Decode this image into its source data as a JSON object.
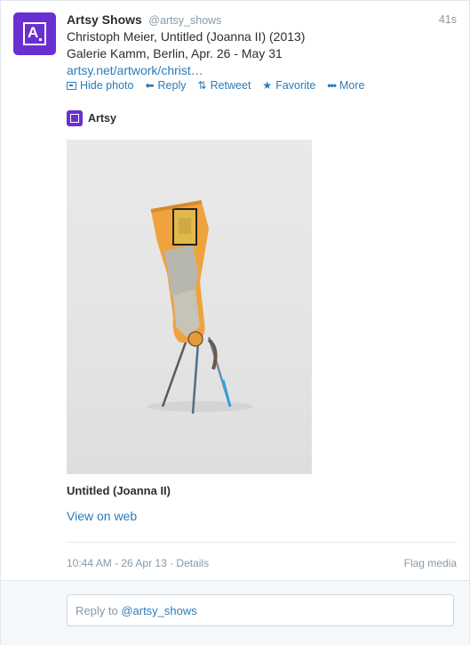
{
  "tweet": {
    "author_name": "Artsy Shows",
    "author_handle": "@artsy_shows",
    "time_ago": "41s",
    "line1": "Christoph Meier, Untitled (Joanna II) (2013)",
    "line2": "Galerie Kamm, Berlin, Apr. 26 - May 31",
    "link": "artsy.net/artwork/christ…"
  },
  "actions": {
    "hide_photo": "Hide photo",
    "reply": "Reply",
    "retweet": "Retweet",
    "favorite": "Favorite",
    "more": "More"
  },
  "card": {
    "brand": "Artsy",
    "artwork_title": "Untitled (Joanna II)",
    "view_on_web": "View on web"
  },
  "meta": {
    "timestamp": "10:44 AM - 26 Apr 13",
    "separator": " · ",
    "details": "Details",
    "flag_media": "Flag media"
  },
  "reply": {
    "prefix": "Reply to ",
    "handle": "@artsy_shows"
  },
  "colors": {
    "brand_purple": "#6a2fd1",
    "link_blue": "#2b7bb9",
    "muted_gray": "#8899a6"
  },
  "icons": {
    "hide_photo": "photo-icon",
    "reply": "reply-arrow-icon",
    "retweet": "retweet-icon",
    "favorite": "star-icon",
    "more": "ellipsis-icon"
  }
}
